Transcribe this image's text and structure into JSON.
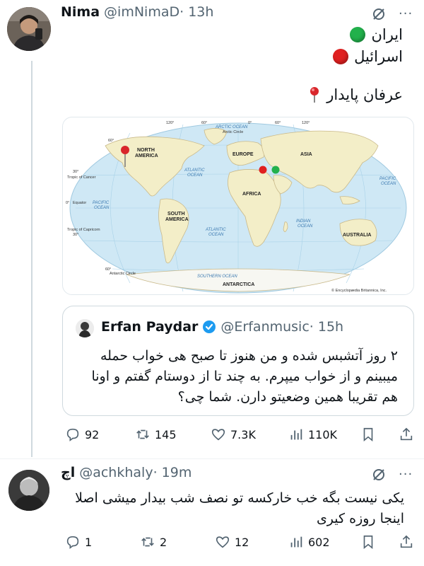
{
  "tweet": {
    "author_name": "Nima",
    "handle": "@imNimaD",
    "time": "· 13h",
    "poll": [
      {
        "label": "ایران",
        "color": "#22b14c"
      },
      {
        "label": "اسرائیل",
        "color": "#e02020"
      }
    ],
    "pin_line": "عرفان پایدار",
    "map": {
      "labels": {
        "north_america": "NORTH",
        "north_america_2": "AMERICA",
        "south_america": "SOUTH",
        "south_america_2": "AMERICA",
        "europe": "EUROPE",
        "asia": "ASIA",
        "africa": "AFRICA",
        "australia": "AUSTRALIA",
        "antarctica": "ANTARCTICA",
        "arctic_ocean": "ARCTIC OCEAN",
        "arctic_circle": "Arctic Circle",
        "atlantic_n": "ATLANTIC",
        "atlantic_n2": "OCEAN",
        "atlantic_s": "ATLANTIC",
        "atlantic_s2": "OCEAN",
        "pacific_e": "PACIFIC",
        "pacific_e2": "OCEAN",
        "pacific_w": "PACIFIC",
        "pacific_w2": "OCEAN",
        "indian": "INDIAN",
        "indian2": "OCEAN",
        "southern": "SOUTHERN OCEAN",
        "tropic_cancer": "Tropic of Cancer",
        "tropic_capricorn": "Tropic of Capricorn",
        "equator": "Equator",
        "antarctic_circle": "Antarctic Circle",
        "lat_30n": "30°",
        "lat_0": "0°",
        "lat_30s": "30°",
        "lat_60n": "60°",
        "lat_60s": "60°",
        "lon_120w": "120°",
        "lon_60w": "60°",
        "lon_0": "0°",
        "lon_60e": "60°",
        "lon_120e": "120°",
        "credit": "© Encyclopædia Britannica, Inc."
      }
    },
    "quote": {
      "author_name": "Erfan Paydar",
      "handle": "@Erfanmusic",
      "time": "· 15h",
      "text": "۲ روز آتشبس شده و من هنوز تا صبح هی خواب حمله میبینم و از خواب میپرم. به چند تا از دوستام گفتم و اونا هم تقریبا همین وضعیتو دارن. شما چی؟"
    },
    "stats": {
      "replies": "92",
      "reposts": "145",
      "likes": "7.3K",
      "views": "110K"
    }
  },
  "reply": {
    "author_name": "اچ",
    "handle": "@achkhaly",
    "time": "· 19m",
    "text": "یکی نیست بگه خب خارکسه تو نصف شب بیدار میشی اصلا اینجا روزه کیری",
    "stats": {
      "replies": "1",
      "reposts": "2",
      "likes": "12",
      "views": "602"
    }
  }
}
